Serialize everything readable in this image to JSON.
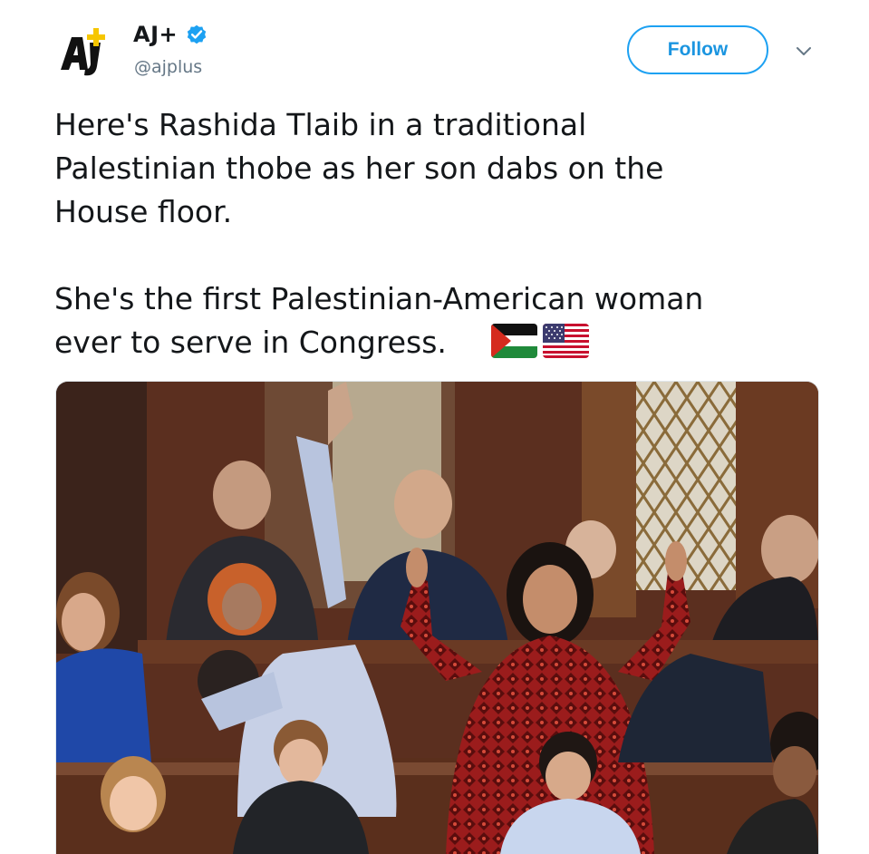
{
  "tweet": {
    "author": {
      "display_name": "AJ+",
      "handle": "@ajplus",
      "verified": true,
      "avatar_icon": "aj-plus-logo"
    },
    "follow_label": "Follow",
    "text": "Here's Rashida Tlaib in a traditional\nPalestinian thobe as her son dabs on the\nHouse floor.\n\nShe's the first Palestinian-American woman\never to serve in Congress.",
    "emoji": [
      "palestine-flag",
      "us-flag"
    ]
  },
  "colors": {
    "accent": "#1da1f2",
    "text": "#14171a",
    "secondary": "#657786"
  }
}
